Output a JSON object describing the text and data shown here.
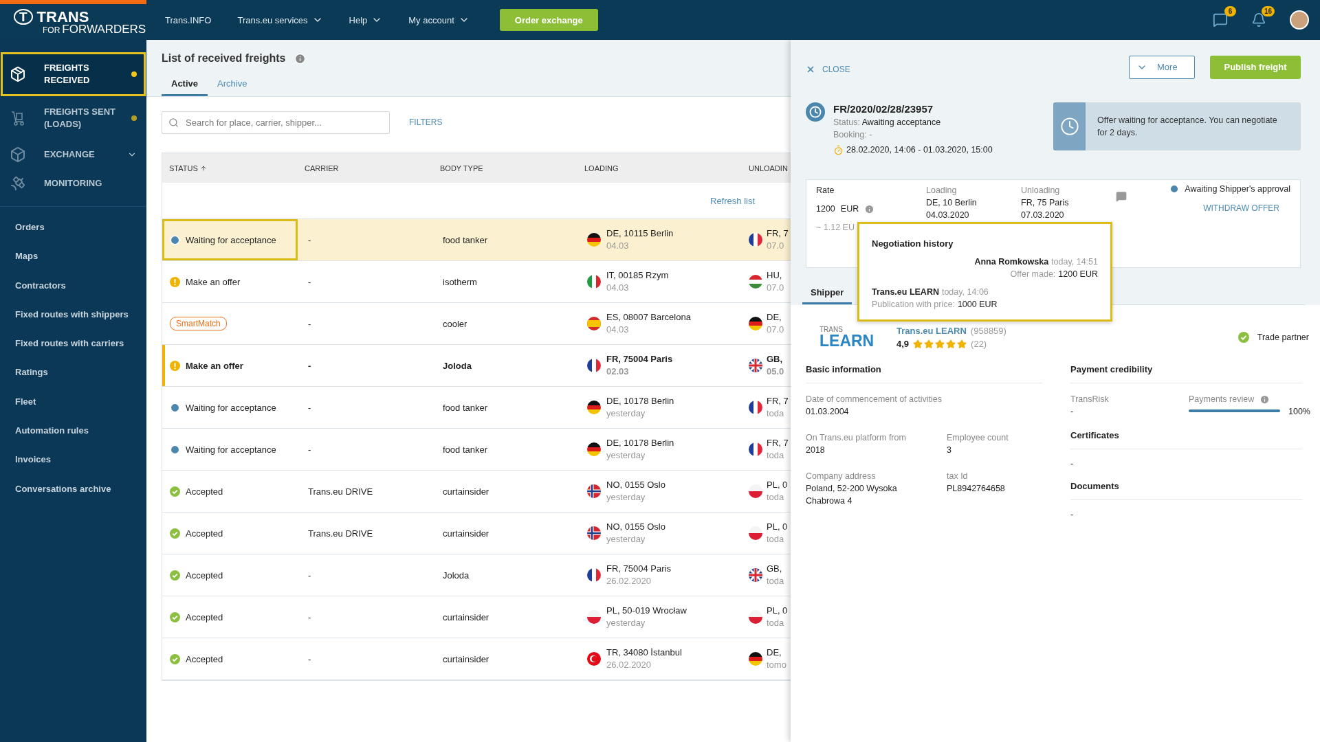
{
  "logo": {
    "mark": "T",
    "brand": "TRANS",
    "sub_prefix": "FOR",
    "sub": "FORWARDERS"
  },
  "top_nav": [
    {
      "label": "Trans.INFO",
      "dropdown": false
    },
    {
      "label": "Trans.eu services",
      "dropdown": true
    },
    {
      "label": "Help",
      "dropdown": true
    },
    {
      "label": "My account",
      "dropdown": true
    }
  ],
  "order_button": "Order exchange",
  "notifications": [
    {
      "kind": "messages",
      "count": "6"
    },
    {
      "kind": "alerts",
      "count": "16"
    }
  ],
  "sidebar": {
    "modules": [
      {
        "label": "FREIGHTS RECEIVED",
        "selected": true,
        "dot": true
      },
      {
        "label": "FREIGHTS SENT (LOADS)",
        "selected": false,
        "dot": true
      },
      {
        "label": "EXCHANGE",
        "selected": false,
        "dot": false,
        "expanded": false
      },
      {
        "label": "MONITORING",
        "selected": false,
        "dot": false
      }
    ],
    "links": [
      "Orders",
      "Maps",
      "Contractors",
      "Fixed routes with shippers",
      "Fixed routes with carriers",
      "Ratings",
      "Fleet",
      "Automation rules",
      "Invoices",
      "Conversations archive"
    ]
  },
  "list": {
    "title": "List of received freights",
    "tabs": [
      {
        "label": "Active",
        "selected": true
      },
      {
        "label": "Archive",
        "selected": false
      }
    ],
    "search_placeholder": "Search for place, carrier, shipper...",
    "filters": "FILTERS",
    "columns": [
      {
        "label": "STATUS",
        "sorted": true
      },
      {
        "label": "CARRIER",
        "sorted": false
      },
      {
        "label": "BODY TYPE",
        "sorted": false
      },
      {
        "label": "LOADING",
        "sorted": false
      },
      {
        "label": "UNLOADIN",
        "sorted": false
      }
    ],
    "refresh": "Refresh list",
    "rows": [
      {
        "kind": "waiting",
        "status": "Waiting for acceptance",
        "carrier": "-",
        "body": "food tanker",
        "loading": {
          "place": "DE, 10115 Berlin",
          "date": "04.03"
        },
        "unloading": {
          "place": "FR, 7",
          "date": "07.0"
        },
        "selected": true,
        "unread": false
      },
      {
        "kind": "offer",
        "status": "Make an offer",
        "carrier": "-",
        "body": "isotherm",
        "loading": {
          "place": "IT, 00185 Rzym",
          "date": "04.03"
        },
        "unloading": {
          "place": "HU,",
          "date": "07.0"
        },
        "selected": false,
        "unread": false
      },
      {
        "kind": "smartmatch",
        "status": "SmartMatch",
        "carrier": "-",
        "body": "cooler",
        "loading": {
          "place": "ES, 08007 Barcelona",
          "date": "04.03"
        },
        "unloading": {
          "place": "DE,",
          "date": "07.0"
        },
        "selected": false,
        "unread": false
      },
      {
        "kind": "offer",
        "status": "Make an offer",
        "carrier": "-",
        "body": "Joloda",
        "loading": {
          "place": "FR, 75004 Paris",
          "date": "02.03"
        },
        "unloading": {
          "place": "GB,",
          "date": "05.0"
        },
        "selected": false,
        "unread": true
      },
      {
        "kind": "waiting",
        "status": "Waiting for acceptance",
        "carrier": "-",
        "body": "food tanker",
        "loading": {
          "place": "DE, 10178 Berlin",
          "date": "yesterday"
        },
        "unloading": {
          "place": "FR, 7",
          "date": "toda"
        },
        "selected": false,
        "unread": false
      },
      {
        "kind": "waiting",
        "status": "Waiting for acceptance",
        "carrier": "-",
        "body": "food tanker",
        "loading": {
          "place": "DE, 10178 Berlin",
          "date": "yesterday"
        },
        "unloading": {
          "place": "FR, 7",
          "date": "toda"
        },
        "selected": false,
        "unread": false
      },
      {
        "kind": "accepted",
        "status": "Accepted",
        "carrier": "Trans.eu DRIVE",
        "body": "curtainsider",
        "loading": {
          "place": "NO, 0155 Oslo",
          "date": "yesterday"
        },
        "unloading": {
          "place": "PL, 0",
          "date": "toda"
        },
        "selected": false,
        "unread": false
      },
      {
        "kind": "accepted",
        "status": "Accepted",
        "carrier": "Trans.eu DRIVE",
        "body": "curtainsider",
        "loading": {
          "place": "NO, 0155 Oslo",
          "date": "yesterday"
        },
        "unloading": {
          "place": "PL, 0",
          "date": "toda"
        },
        "selected": false,
        "unread": false
      },
      {
        "kind": "accepted",
        "status": "Accepted",
        "carrier": "-",
        "body": "Joloda",
        "loading": {
          "place": "FR, 75004 Paris",
          "date": "26.02.2020"
        },
        "unloading": {
          "place": "GB,",
          "date": "toda"
        },
        "selected": false,
        "unread": false
      },
      {
        "kind": "accepted",
        "status": "Accepted",
        "carrier": "-",
        "body": "curtainsider",
        "loading": {
          "place": "PL, 50-019 Wrocław",
          "date": "yesterday"
        },
        "unloading": {
          "place": "PL, 0",
          "date": "toda"
        },
        "selected": false,
        "unread": false
      },
      {
        "kind": "accepted",
        "status": "Accepted",
        "carrier": "-",
        "body": "curtainsider",
        "loading": {
          "place": "TR, 34080 İstanbul",
          "date": "26.02.2020"
        },
        "unloading": {
          "place": "DE,",
          "date": "tomo"
        },
        "selected": false,
        "unread": false
      }
    ]
  },
  "detail": {
    "close": "CLOSE",
    "more": "More",
    "publish": "Publish freight",
    "id": "FR/2020/02/28/23957",
    "status_label": "Status:",
    "status": "Awaiting acceptance",
    "booking_label": "Booking:",
    "booking": "-",
    "period": "28.02.2020, 14:06 - 01.03.2020, 15:00",
    "notice": "Offer waiting for acceptance. You can negotiate for 2 days.",
    "rate": {
      "label": "Rate",
      "amount": "1200",
      "currency": "EUR",
      "per_km": "~ 1.12 EU"
    },
    "loading": {
      "label": "Loading",
      "place": "DE, 10 Berlin",
      "date": "04.03.2020"
    },
    "unloading": {
      "label": "Unloading",
      "place": "FR, 75 Paris",
      "date": "07.03.2020"
    },
    "approval": "Awaiting Shipper's approval",
    "withdraw": "WITHDRAW OFFER",
    "history": {
      "title": "Negotiation history",
      "entries": [
        {
          "author": "Anna Romkowska",
          "time": "today, 14:51",
          "label": "Offer made:",
          "value": "1200 EUR",
          "kind": "offer"
        },
        {
          "author": "Trans.eu LEARN",
          "time": "today, 14:06",
          "label": "Publication with price:",
          "value": "1000 EUR",
          "kind": "publication"
        }
      ]
    },
    "tabs": [
      {
        "label": "Shipper",
        "selected": true
      }
    ],
    "company": {
      "logo_top": "TRANS",
      "logo_main": "LEARN",
      "name": "Trans.eu LEARN",
      "number": "(958859)",
      "rating": "4,9",
      "stars": 5,
      "reviews": "(22)",
      "trade_partner": "Trade partner"
    },
    "basic": {
      "title": "Basic information",
      "fields": [
        {
          "label": "Date of commencement of activities",
          "value": "01.03.2004",
          "wide": true
        },
        {
          "label": "On Trans.eu platform from",
          "value": "2018",
          "wide": false
        },
        {
          "label": "Employee count",
          "value": "3",
          "wide": false
        },
        {
          "label": "Company address",
          "value": "Poland, 52-200 Wysoka\nChabrowa 4",
          "wide": false
        },
        {
          "label": "tax Id",
          "value": "PL8942764658",
          "wide": false
        }
      ]
    },
    "payment": {
      "title": "Payment credibility",
      "risk_label": "TransRisk",
      "risk": "-",
      "review_label": "Payments review",
      "level": 1,
      "review_value": "100%"
    },
    "sections": [
      {
        "title": "Certificates",
        "value": "-"
      },
      {
        "title": "Documents",
        "value": "-"
      }
    ]
  }
}
